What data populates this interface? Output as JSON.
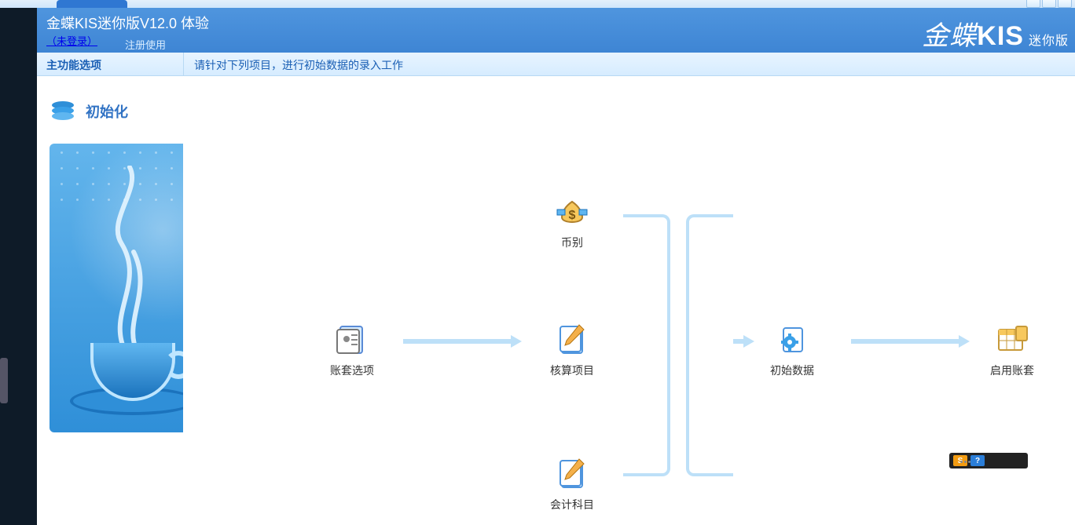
{
  "header": {
    "title": "金蝶KIS迷你版V12.0  体验",
    "login_link": "（未登录）",
    "register_link": "注册使用",
    "brand_prefix": "金蝶",
    "brand_main": "KIS",
    "brand_suffix": "迷你版"
  },
  "subheader": {
    "options_label": "主功能选项",
    "hint": "请针对下列项目，进行初始数据的录入工作"
  },
  "sidebar": {
    "items": [
      {
        "label": "初始化",
        "icon": "stack-icon"
      }
    ]
  },
  "flow": {
    "nodes": {
      "account_options": {
        "label": "账套选项",
        "icon": "settings-doc-icon"
      },
      "currency": {
        "label": "币别",
        "icon": "money-bag-icon"
      },
      "accounting_item": {
        "label": "核算项目",
        "icon": "notepad-icon"
      },
      "accounting_subj": {
        "label": "会计科目",
        "icon": "notepad-icon"
      },
      "initial_data": {
        "label": "初始数据",
        "icon": "gear-doc-icon"
      },
      "enable_account": {
        "label": "启用账套",
        "icon": "spreadsheet-icon"
      }
    }
  },
  "tray": {
    "sogou": "S",
    "help": "?"
  }
}
